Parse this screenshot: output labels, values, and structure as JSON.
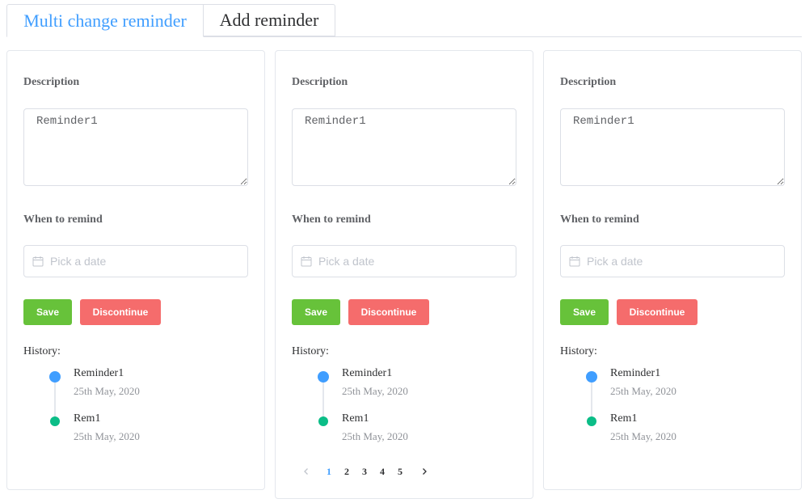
{
  "tabs": [
    {
      "label": "Multi change reminder"
    },
    {
      "label": "Add reminder"
    }
  ],
  "cards": [
    {
      "description_label": "Description",
      "description_value": "Reminder1",
      "when_label": "When to remind",
      "date_placeholder": "Pick a date",
      "save_label": "Save",
      "discontinue_label": "Discontinue",
      "history_label": "History:",
      "history": [
        {
          "title": "Reminder1",
          "time": "25th May, 2020"
        },
        {
          "title": "Rem1",
          "time": "25th May, 2020"
        }
      ]
    },
    {
      "description_label": "Description",
      "description_value": "Reminder1",
      "when_label": "When to remind",
      "date_placeholder": "Pick a date",
      "save_label": "Save",
      "discontinue_label": "Discontinue",
      "history_label": "History:",
      "history": [
        {
          "title": "Reminder1",
          "time": "25th May, 2020"
        },
        {
          "title": "Rem1",
          "time": "25th May, 2020"
        }
      ],
      "pagination": {
        "pages": [
          "1",
          "2",
          "3",
          "4",
          "5"
        ],
        "current": "1"
      }
    },
    {
      "description_label": "Description",
      "description_value": "Reminder1",
      "when_label": "When to remind",
      "date_placeholder": "Pick a date",
      "save_label": "Save",
      "discontinue_label": "Discontinue",
      "history_label": "History:",
      "history": [
        {
          "title": "Reminder1",
          "time": "25th May, 2020"
        },
        {
          "title": "Rem1",
          "time": "25th May, 2020"
        }
      ]
    }
  ],
  "colors": {
    "accent": "#409eff",
    "save": "#67c23a",
    "discontinue": "#f56c6c",
    "timeline_first": "#409eff",
    "timeline_second": "#0bbd87"
  },
  "icons": {
    "date_picker": "calendar-icon",
    "prev": "chevron-left-icon",
    "next": "chevron-right-icon"
  }
}
